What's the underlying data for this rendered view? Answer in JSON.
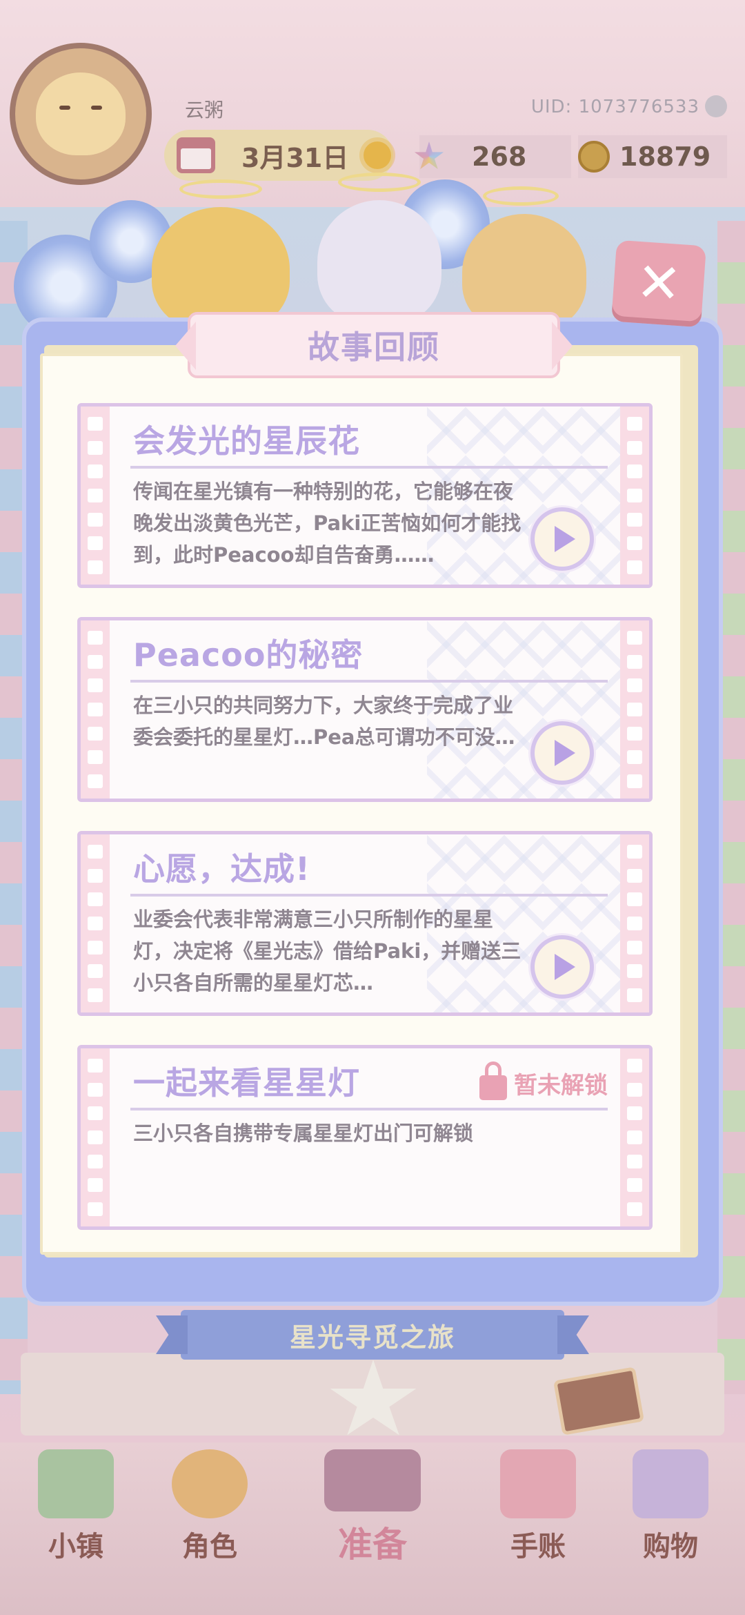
{
  "hud": {
    "username": "云粥",
    "uid": "UID: 1073776533",
    "date": "3月31日",
    "stars": "268",
    "coins": "18879"
  },
  "dialog": {
    "title": "故事回顾",
    "close_icon": "close-x",
    "stories": [
      {
        "title": "会发光的星辰花",
        "description": "传闻在星光镇有一种特别的花，它能够在夜晚发出淡黄色光芒，Paki正苦恼如何才能找到，此时Peacoo却自告奋勇……",
        "locked": false
      },
      {
        "title": "Peacoo的秘密",
        "description": "在三小只的共同努力下，大家终于完成了业委会委托的星星灯…Pea总可谓功不可没…",
        "locked": false
      },
      {
        "title": "心愿，达成!",
        "description": "业委会代表非常满意三小只所制作的星星灯，决定将《星光志》借给Paki，并赠送三小只各自所需的星星灯芯…",
        "locked": false
      },
      {
        "title": "一起来看星星灯",
        "description": "三小只各自携带专属星星灯出门可解锁",
        "locked": true,
        "lock_label": "暂未解锁"
      }
    ]
  },
  "bottom": {
    "banner": "星光寻觅之旅"
  },
  "nav": {
    "items": [
      {
        "label": "小镇",
        "icon": "town-icon"
      },
      {
        "label": "角色",
        "icon": "character-icon"
      },
      {
        "label": "准备",
        "icon": "prepare-icon"
      },
      {
        "label": "手账",
        "icon": "journal-icon"
      },
      {
        "label": "购物",
        "icon": "shop-icon"
      }
    ]
  },
  "colors": {
    "dialog_frame": "#a9b5ee",
    "card_title": "#b9a6e3",
    "lock": "#e9a2b4",
    "close_button": "#e9a4b2"
  }
}
